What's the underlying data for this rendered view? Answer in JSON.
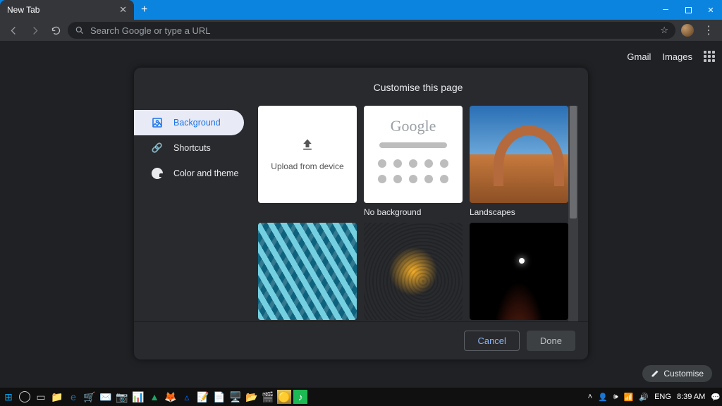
{
  "titlebar": {
    "tab_title": "New Tab"
  },
  "toolbar": {
    "search_placeholder": "Search Google or type a URL"
  },
  "ntp": {
    "gmail": "Gmail",
    "images": "Images",
    "customise_chip": "Customise"
  },
  "dialog": {
    "title": "Customise this page",
    "sidebar": {
      "background": "Background",
      "shortcuts": "Shortcuts",
      "colortheme": "Color and theme"
    },
    "upload_label": "Upload from device",
    "nobg_caption": "No background",
    "nobg_logo": "Google",
    "landscapes_caption": "Landscapes",
    "cancel": "Cancel",
    "done": "Done"
  },
  "tray": {
    "lang": "ENG",
    "time": "8:39 AM"
  }
}
